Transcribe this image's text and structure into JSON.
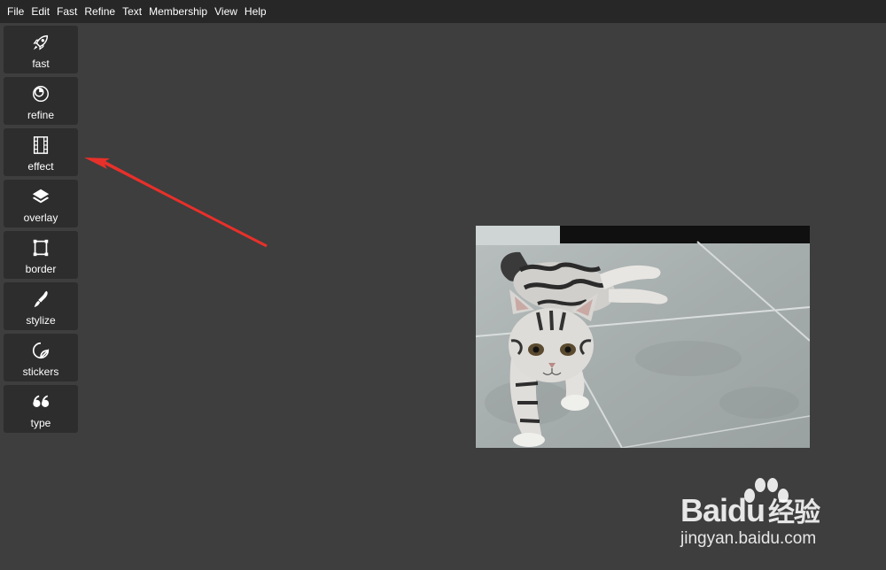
{
  "menubar": {
    "items": [
      "File",
      "Edit",
      "Fast",
      "Refine",
      "Text",
      "Membership",
      "View",
      "Help"
    ]
  },
  "sidebar": {
    "tools": [
      {
        "label": "fast",
        "icon": "rocket-icon"
      },
      {
        "label": "refine",
        "icon": "refine-icon"
      },
      {
        "label": "effect",
        "icon": "film-icon"
      },
      {
        "label": "overlay",
        "icon": "layers-icon"
      },
      {
        "label": "border",
        "icon": "border-icon"
      },
      {
        "label": "stylize",
        "icon": "brush-icon"
      },
      {
        "label": "stickers",
        "icon": "sticker-icon"
      },
      {
        "label": "type",
        "icon": "quote-icon"
      }
    ]
  },
  "canvas": {
    "image": "kitten-on-tile-floor"
  },
  "annotation": {
    "arrow_color": "#e8302a"
  },
  "watermark": {
    "brand_latin": "Bai",
    "brand_du": "du",
    "brand_cn": "经验",
    "url": "jingyan.baidu.com"
  },
  "colors": {
    "background": "#3e3e3e",
    "menubar": "#272727",
    "tool_button": "#2d2d2d"
  }
}
